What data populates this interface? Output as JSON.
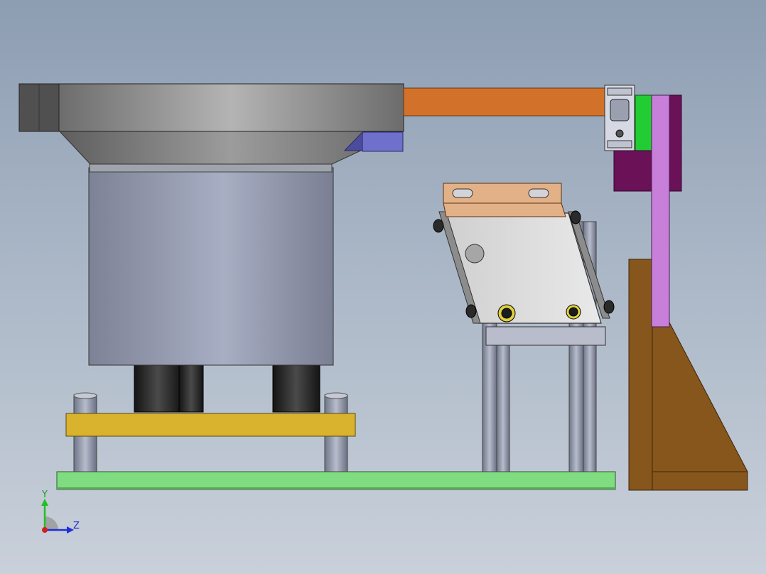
{
  "triad": {
    "y_label": "Y",
    "z_label": "Z"
  },
  "colors": {
    "background_top": "#8d9db2",
    "background_bottom": "#c9d0da",
    "base_plate": "#80dc80",
    "mid_plate": "#d9b32d",
    "bowl_body": "#a3a9bd",
    "bowl_rim": "#9a9a9a",
    "linear_track": "#d2722a",
    "vertical_arm": "#c77fd9",
    "green_block": "#22cc33",
    "purple_block": "#6a1158",
    "bracket": "#86561c",
    "copper_plate": "#e3b187",
    "blue_block": "#6f70cc"
  }
}
